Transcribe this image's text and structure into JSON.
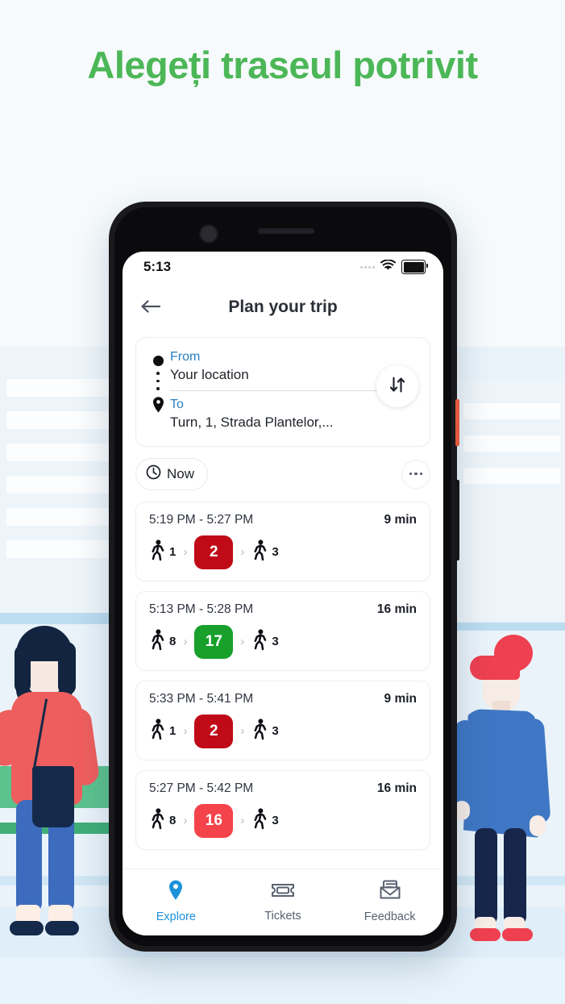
{
  "headline": "Alegeți traseul potrivit",
  "theme": {
    "headline_color": "#4cb757",
    "accent_blue": "#2a7fc1",
    "nav_active": "#1c92d8"
  },
  "status_bar": {
    "time": "5:13",
    "signal_icon": "signal-dots-icon",
    "wifi_icon": "wifi-icon",
    "battery_icon": "battery-full-icon"
  },
  "header": {
    "back_icon": "back-arrow-icon",
    "title": "Plan your trip"
  },
  "trip_form": {
    "from_label": "From",
    "from_value": "Your location",
    "to_label": "To",
    "to_value": "Turn, 1, Strada Plantelor,...",
    "origin_icon": "origin-dot-icon",
    "destination_icon": "map-pin-icon",
    "swap_icon": "swap-arrows-icon"
  },
  "filters": {
    "time_chip": "Now",
    "clock_icon": "clock-icon",
    "more_icon": "more-options-icon"
  },
  "routes": [
    {
      "time_range": "5:19 PM - 5:27 PM",
      "duration": "9 min",
      "walk_before": "1",
      "line": "2",
      "line_color": "#c00a17",
      "walk_after": "3"
    },
    {
      "time_range": "5:13 PM - 5:28 PM",
      "duration": "16 min",
      "walk_before": "8",
      "line": "17",
      "line_color": "#18a02a",
      "walk_after": "3"
    },
    {
      "time_range": "5:33 PM - 5:41 PM",
      "duration": "9 min",
      "walk_before": "1",
      "line": "2",
      "line_color": "#c00a17",
      "walk_after": "3"
    },
    {
      "time_range": "5:27 PM - 5:42 PM",
      "duration": "16 min",
      "walk_before": "8",
      "line": "16",
      "line_color": "#f4434a",
      "walk_after": "3"
    }
  ],
  "bottom_nav": [
    {
      "label": "Explore",
      "icon": "map-pin-icon",
      "active": true
    },
    {
      "label": "Tickets",
      "icon": "ticket-icon",
      "active": false
    },
    {
      "label": "Feedback",
      "icon": "envelope-icon",
      "active": false
    }
  ]
}
